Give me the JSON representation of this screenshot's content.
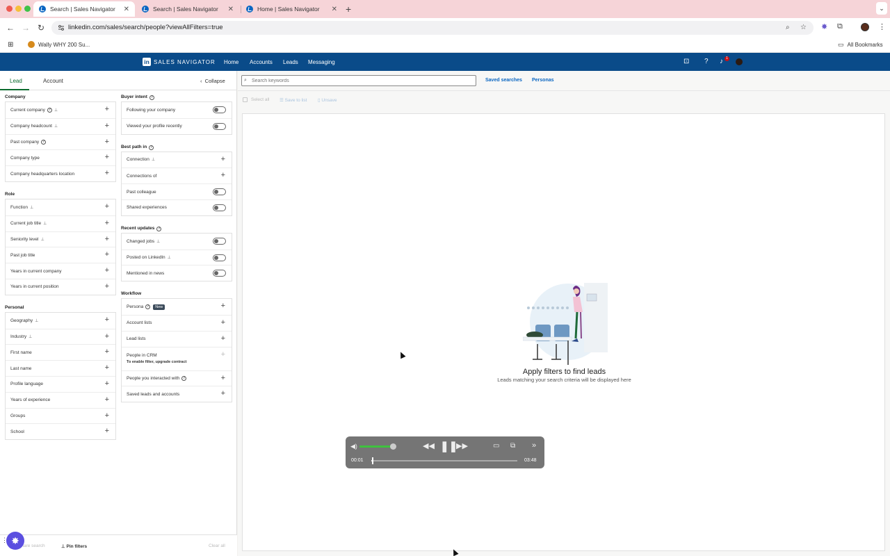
{
  "browser": {
    "tabs": [
      {
        "title": "Search | Sales Navigator",
        "active": true
      },
      {
        "title": "Search | Sales Navigator",
        "active": false
      },
      {
        "title": "Home | Sales Navigator",
        "active": false
      }
    ],
    "url": "linkedin.com/sales/search/people?viewAllFilters=true",
    "bookmarks": {
      "item": "Wally WHY 200 Su...",
      "all": "All Bookmarks"
    }
  },
  "navbar": {
    "logo": "in",
    "brand": "SALES NAVIGATOR",
    "links": [
      "Home",
      "Accounts",
      "Leads",
      "Messaging"
    ],
    "notification_count": "1"
  },
  "filters": {
    "tabs": [
      "Lead",
      "Account"
    ],
    "collapse": "Collapse",
    "left_sections": [
      {
        "title": "Company",
        "rows": [
          {
            "label": "Current company",
            "help": true,
            "pin": true
          },
          {
            "label": "Company headcount",
            "pin": true
          },
          {
            "label": "Past company",
            "help": true
          },
          {
            "label": "Company type"
          },
          {
            "label": "Company headquarters location"
          }
        ]
      },
      {
        "title": "Role",
        "rows": [
          {
            "label": "Function",
            "pin": true
          },
          {
            "label": "Current job title",
            "pin": true
          },
          {
            "label": "Seniority level",
            "pin": true
          },
          {
            "label": "Past job title"
          },
          {
            "label": "Years in current company"
          },
          {
            "label": "Years in current position"
          }
        ]
      },
      {
        "title": "Personal",
        "rows": [
          {
            "label": "Geography",
            "pin": true
          },
          {
            "label": "Industry",
            "pin": true
          },
          {
            "label": "First name"
          },
          {
            "label": "Last name"
          },
          {
            "label": "Profile language"
          },
          {
            "label": "Years of experience"
          },
          {
            "label": "Groups"
          },
          {
            "label": "School"
          }
        ]
      }
    ],
    "right_sections": [
      {
        "title": "Buyer intent",
        "help": true,
        "rows": [
          {
            "label": "Following your company",
            "toggle": true
          },
          {
            "label": "Viewed your profile recently",
            "toggle": true
          }
        ]
      },
      {
        "title": "Best path in",
        "help": true,
        "rows": [
          {
            "label": "Connection",
            "pin": true
          },
          {
            "label": "Connections of"
          },
          {
            "label": "Past colleague",
            "toggle": true
          },
          {
            "label": "Shared experiences",
            "toggle": true
          }
        ]
      },
      {
        "title": "Recent updates",
        "help": true,
        "rows": [
          {
            "label": "Changed jobs",
            "pin": true,
            "toggle": true
          },
          {
            "label": "Posted on LinkedIn",
            "pin": true,
            "toggle": true
          },
          {
            "label": "Mentioned in news",
            "toggle": true
          }
        ]
      },
      {
        "title": "Workflow",
        "rows": [
          {
            "label": "Persona",
            "help": true,
            "badge": "New"
          },
          {
            "label": "Account lists"
          },
          {
            "label": "Lead lists"
          },
          {
            "label": "People in CRM",
            "sub": "To enable filter, upgrade contract",
            "disabled": true
          },
          {
            "label": "People you interacted with",
            "help": true
          },
          {
            "label": "Saved leads and accounts"
          }
        ]
      }
    ],
    "footer": {
      "share": "Share search",
      "pin": "Pin filters",
      "clear": "Clear all"
    }
  },
  "search": {
    "placeholder": "Search keywords",
    "saved_searches": "Saved searches",
    "personas": "Personas",
    "actions": {
      "select_all": "Select all",
      "save_to_list": "Save to list",
      "unsave": "Unsave"
    },
    "empty_title": "Apply filters to find leads",
    "empty_subtitle": "Leads matching your search criteria will be displayed here"
  },
  "player": {
    "current_time": "00:01",
    "duration": "03:48",
    "volume_fraction": 0.95,
    "progress_fraction": 0.005
  },
  "colors": {
    "linkedin_navy": "#0a4b89",
    "lead_tab_green": "#0b6b2e",
    "link_blue": "#0a66c2",
    "volume_green": "#3ec13e"
  }
}
